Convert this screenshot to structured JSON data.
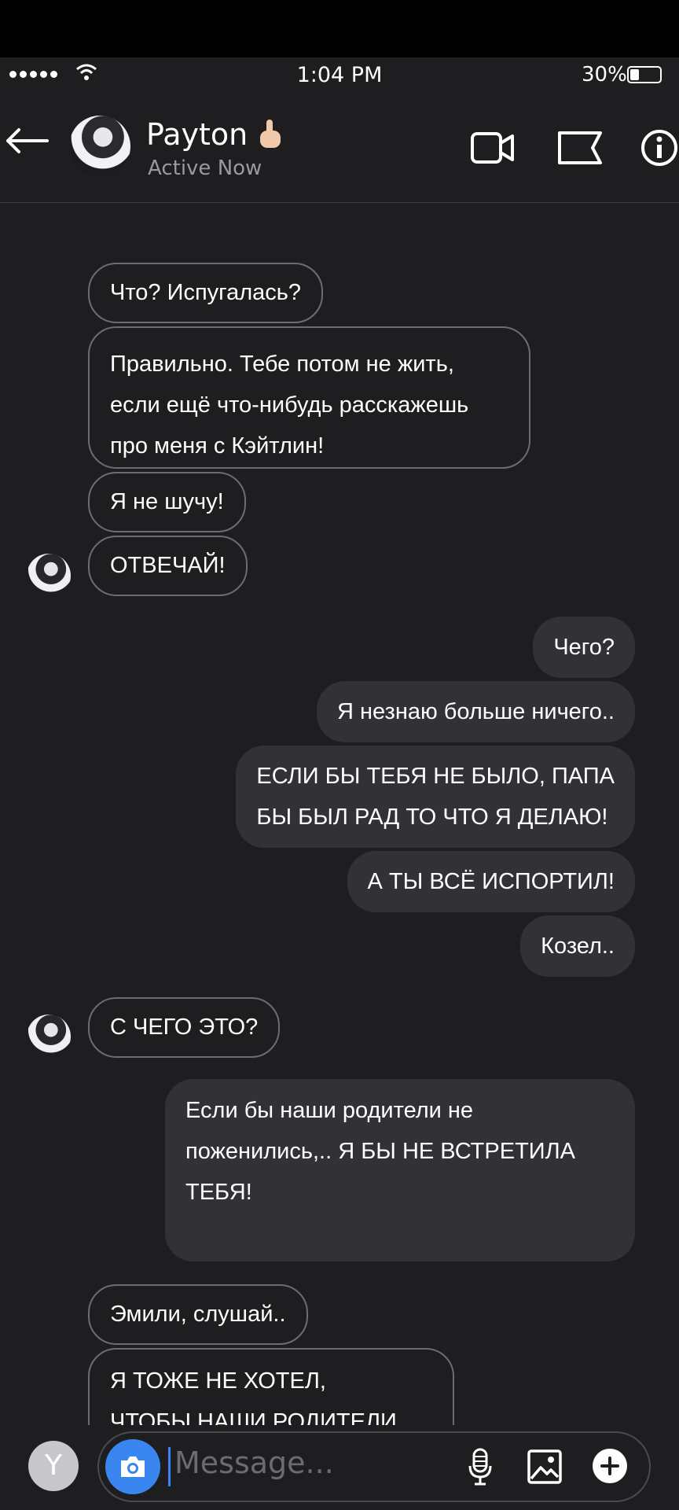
{
  "status_bar": {
    "time": "1:04 PM",
    "battery_percent": "30%",
    "battery_level": 0.3
  },
  "header": {
    "contact_name": "Payton",
    "presence": "Active Now"
  },
  "messages": [
    {
      "direction": "in",
      "lines": [
        "Что? Испугалась?"
      ]
    },
    {
      "direction": "in",
      "lines": [
        "Правильно. Тебе потом не жить,",
        "если ещё что-нибудь расскажешь",
        "про меня с Кэйтлин!"
      ]
    },
    {
      "direction": "in",
      "lines": [
        "Я не шучу!"
      ]
    },
    {
      "direction": "in",
      "lines": [
        "ОТВЕЧАЙ!"
      ]
    },
    {
      "direction": "out",
      "lines": [
        "Чего?"
      ]
    },
    {
      "direction": "out",
      "lines": [
        "Я незнаю больше ничего.."
      ]
    },
    {
      "direction": "out",
      "lines": [
        "ЕСЛИ БЫ ТЕБЯ НЕ БЫЛО, ПАПА",
        "БЫ БЫЛ РАД ТО ЧТО Я ДЕЛАЮ!"
      ]
    },
    {
      "direction": "out",
      "lines": [
        "А ТЫ ВСЁ ИСПОРТИЛ!"
      ]
    },
    {
      "direction": "out",
      "lines": [
        "Козел.."
      ]
    },
    {
      "direction": "in",
      "lines": [
        "С ЧЕГО ЭТО?"
      ]
    },
    {
      "direction": "out",
      "lines": [
        "Если бы наши родители не",
        "поженились,.. Я БЫ НЕ ВСТРЕТИЛА",
        "ТЕБЯ!"
      ]
    },
    {
      "direction": "in",
      "lines": [
        "Эмили, слушай.."
      ]
    },
    {
      "direction": "in",
      "lines": [
        "Я ТОЖЕ НЕ ХОТЕЛ,",
        "ЧТОБЫ НАШИ РОДИТЕЛИ"
      ]
    }
  ],
  "composer": {
    "user_initial": "Y",
    "placeholder": "Message..."
  },
  "colors": {
    "background": "#1e1d20",
    "outgoing_bubble": "#323136",
    "incoming_border": "#6d6c71",
    "accent": "#3a86f0"
  },
  "icons": [
    "back-arrow-icon",
    "video-call-icon",
    "flag-icon",
    "info-icon",
    "camera-icon",
    "microphone-icon",
    "image-icon",
    "plus-icon"
  ]
}
